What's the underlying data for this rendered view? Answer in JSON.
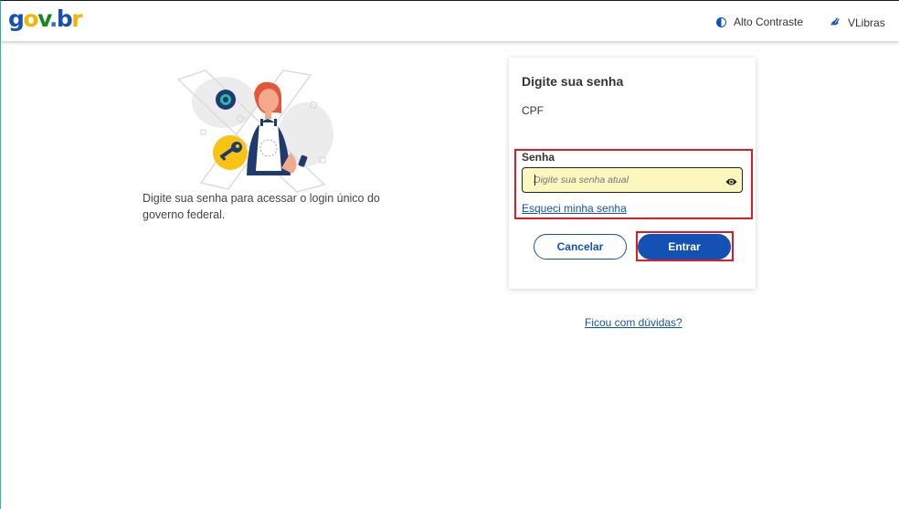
{
  "header": {
    "logo_parts": [
      "g",
      "o",
      "v",
      ".",
      "b",
      "r"
    ],
    "high_contrast_label": "Alto Contraste",
    "vlibras_label": "VLibras"
  },
  "left": {
    "intro_text": "Digite sua senha para acessar o login único do governo federal."
  },
  "card": {
    "title": "Digite sua senha",
    "cpf_label": "CPF",
    "password_label": "Senha",
    "password_placeholder": "Digite sua senha atual",
    "password_value": "",
    "forgot_link": "Esqueci minha senha",
    "cancel_button": "Cancelar",
    "enter_button": "Entrar"
  },
  "help_link": "Ficou com dúvidas?",
  "colors": {
    "brand_blue": "#1351b4",
    "brand_yellow": "#f8b500",
    "brand_green": "#168821",
    "highlight_red": "#e01b22",
    "input_bg": "#fcf6bf"
  }
}
